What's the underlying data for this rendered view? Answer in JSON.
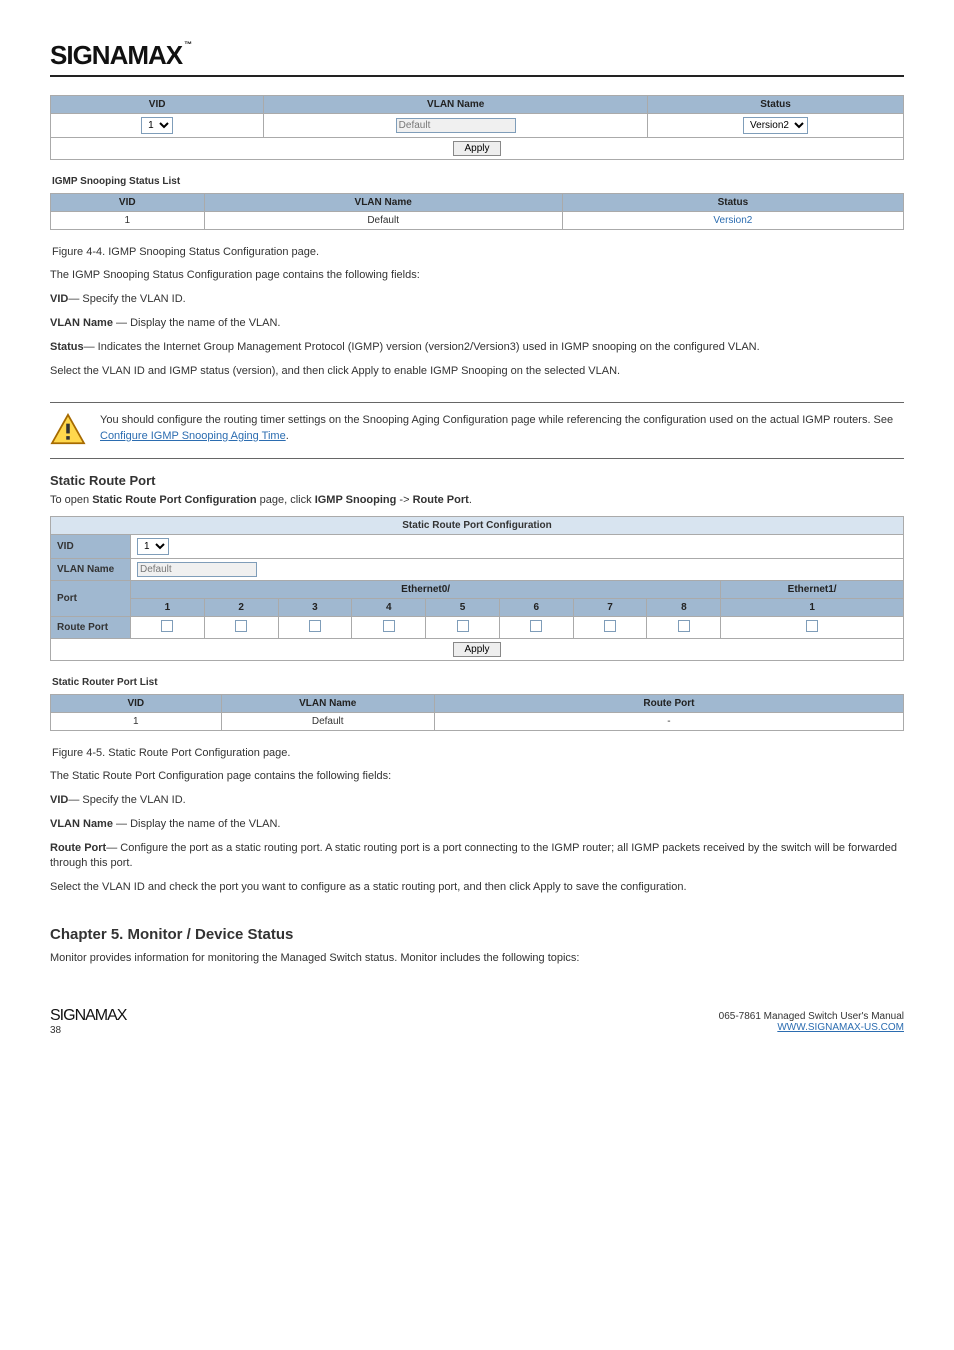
{
  "brand": "SIGNAMAX",
  "brand_tm": "™",
  "vlan_status_cfg": {
    "headers": {
      "vid": "VID",
      "vlan_name": "VLAN Name",
      "status": "Status"
    },
    "row": {
      "vid_options": [
        "1"
      ],
      "vid_selected": "1",
      "vlan_name_value": "Default",
      "status_options": [
        "Version2"
      ],
      "status_selected": "Version2"
    },
    "apply_label": "Apply"
  },
  "igmp_status_list": {
    "title": "IGMP Snooping Status List",
    "headers": {
      "vid": "VID",
      "vlan_name": "VLAN Name",
      "status": "Status"
    },
    "data": {
      "vid": "1",
      "vlan_name": "Default",
      "status": "Version2"
    }
  },
  "fig_4_4": "Figure 4-4. IGMP Snooping Status Configuration page.",
  "status_para": {
    "intro": "The IGMP Snooping Status Configuration page contains the following fields:",
    "items": [
      {
        "label": "VID",
        "desc": "—   Specify the VLAN ID."
      },
      {
        "label": "VLAN Name",
        "desc": " —   Display the name of the VLAN."
      },
      {
        "label": "Status",
        "desc": "— Indicates the Internet Group Management Protocol (IGMP) version (version2/Version3) used in IGMP snooping on the configured VLAN."
      }
    ],
    "outro": "Select the VLAN ID and IGMP status (version), and then click Apply to enable IGMP Snooping on the selected VLAN."
  },
  "caution": {
    "text_1": "You should configure the routing timer settings on the Snooping Aging Configuration page while referencing the configuration used on the actual IGMP routers. See ",
    "link_text": "Configure IGMP Snooping Aging Time",
    "text_2": "."
  },
  "routeport_section": {
    "title": "Static Route Port",
    "nav_intro": "To open ",
    "nav_path": "Static Route Port Configuration",
    "nav_rest": " page, click ",
    "nav_steps_1": "IGMP Snooping",
    "nav_arrow": " -> ",
    "nav_steps_2": "Route Port",
    "nav_period": "."
  },
  "route_cfg": {
    "panel_title": "Static Route Port Configuration",
    "vid_label": "VID",
    "vid_options": [
      "1"
    ],
    "vid_selected": "1",
    "vlan_name_label": "VLAN Name",
    "vlan_name_value": "Default",
    "port_label": "Port",
    "eth0_label": "Ethernet0/",
    "eth1_label": "Ethernet1/",
    "eth0_ports": [
      "1",
      "2",
      "3",
      "4",
      "5",
      "6",
      "7",
      "8"
    ],
    "eth1_ports": [
      "1"
    ],
    "routeport_label": "Route Port",
    "apply_label": "Apply"
  },
  "router_list": {
    "title": "Static Router Port List",
    "headers": {
      "vid": "VID",
      "vlan_name": "VLAN Name",
      "routeport": "Route Port"
    },
    "data": {
      "vid": "1",
      "vlan_name": "Default",
      "routeport": "-"
    }
  },
  "fig_4_5": "Figure 4-5.  Static Route Port Configuration page.",
  "route_para": {
    "intro": "The Static Route Port Configuration page contains the following fields:",
    "items": [
      {
        "label": "VID",
        "desc": "—   Specify the VLAN ID."
      },
      {
        "label": "VLAN Name",
        "desc": " —   Display the name of the VLAN."
      },
      {
        "label": "Route Port",
        "desc": "— Configure the port as a static routing port. A static routing port is a port connecting to the IGMP router; all IGMP packets received by the switch will be forwarded through this port."
      }
    ],
    "outro": "Select the VLAN ID and check the port you want to configure as a static routing port, and then click Apply to save the configuration."
  },
  "chapter5": {
    "head": "Chapter 5.  Monitor / Device Status",
    "para": "Monitor provides information for monitoring the Managed Switch status. Monitor includes the following topics:"
  },
  "footer": {
    "brand": "SIGNAMAX",
    "page": "38",
    "title": "065-7861 Managed Switch User's Manual",
    "url_label": "WWW.SIGNAMAX-US.COM"
  }
}
